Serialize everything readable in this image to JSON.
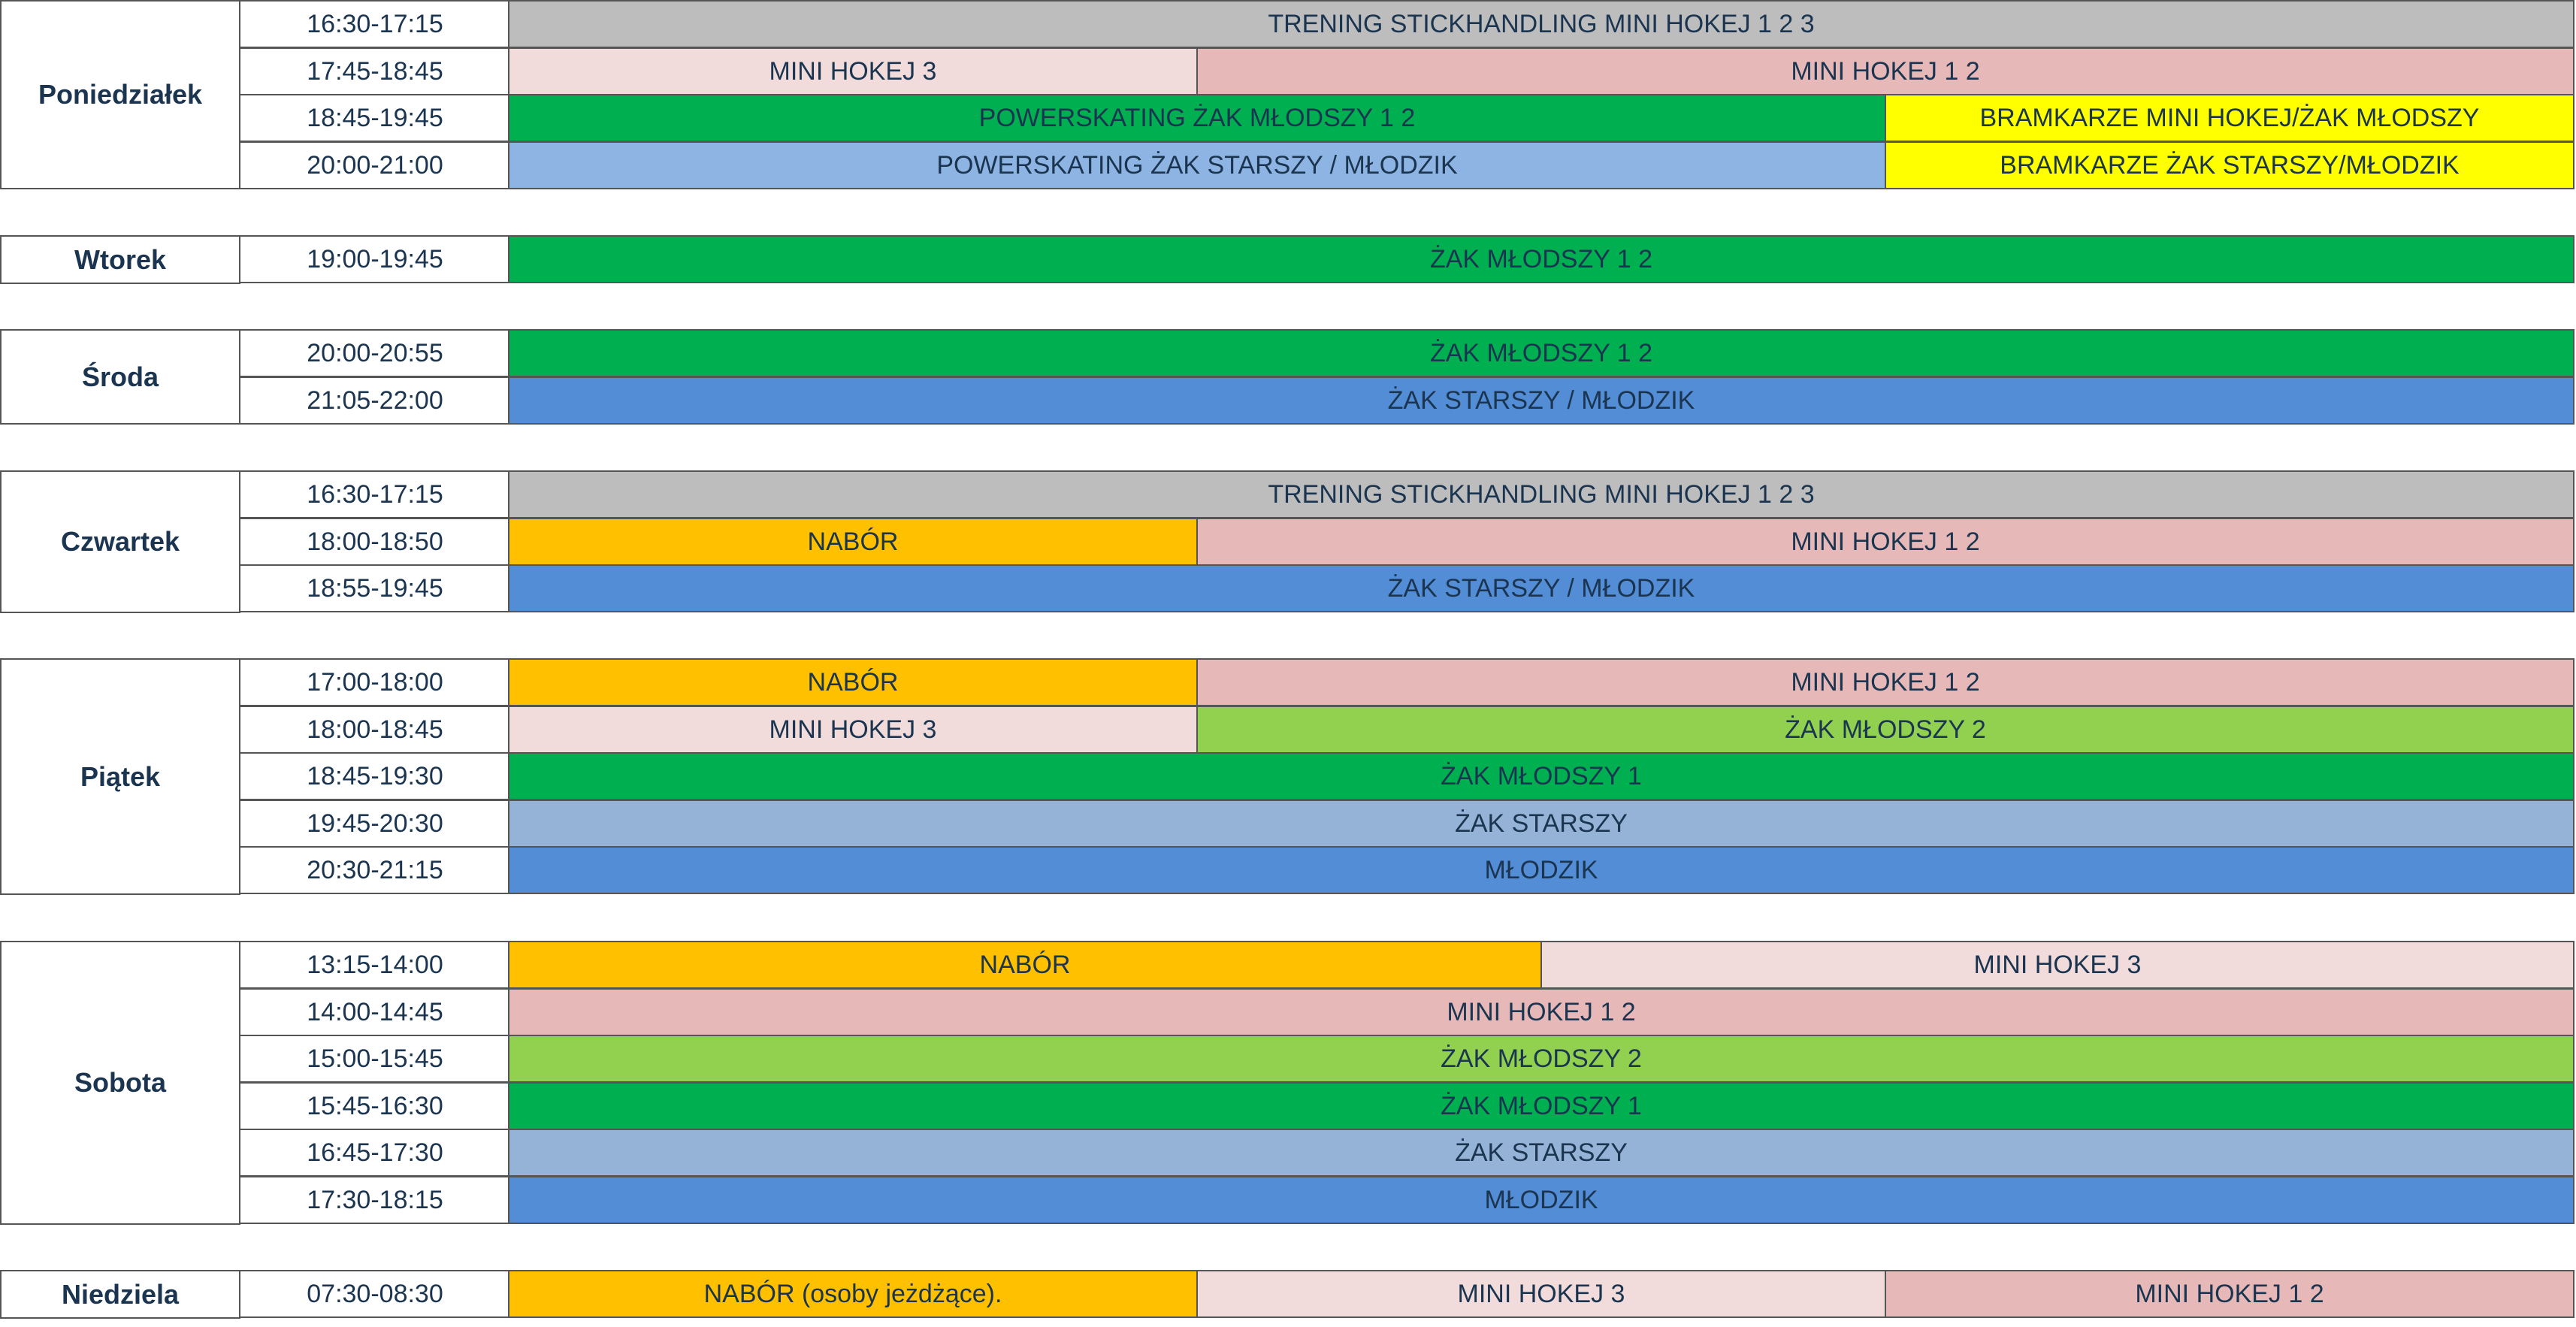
{
  "colors": {
    "gray": "#bdbdbd",
    "pink_light": "#f2dcdb",
    "pink": "#e6b8b7",
    "green_dark": "#00b050",
    "green_light": "#92d050",
    "blue_light": "#8db4e2",
    "blue_gray": "#95b3d7",
    "blue": "#538dd5",
    "yellow": "#ffff00",
    "orange": "#ffc000",
    "text": "#1b3550"
  },
  "days": [
    {
      "day": "Poniedziałek",
      "rows": [
        {
          "time": "16:30-17:15",
          "cells": [
            {
              "label": "TRENING STICKHANDLING MINI HOKEJ 1 2 3",
              "color": "#bdbdbd",
              "span": 6
            }
          ]
        },
        {
          "time": "17:45-18:45",
          "cells": [
            {
              "label": "MINI HOKEJ 3",
              "color": "#f2dcdb",
              "span": 2
            },
            {
              "label": "MINI HOKEJ 1 2",
              "color": "#e6b8b7",
              "span": 4
            }
          ]
        },
        {
          "time": "18:45-19:45",
          "cells": [
            {
              "label": "POWERSKATING ŻAK MŁODSZY 1 2",
              "color": "#00b050",
              "span": 4
            },
            {
              "label": "BRAMKARZE MINI HOKEJ/ŻAK MŁODSZY",
              "color": "#ffff00",
              "span": 2
            }
          ]
        },
        {
          "time": "20:00-21:00",
          "cells": [
            {
              "label": "POWERSKATING ŻAK STARSZY / MŁODZIK",
              "color": "#8db4e2",
              "span": 4
            },
            {
              "label": "BRAMKARZE ŻAK STARSZY/MŁODZIK",
              "color": "#ffff00",
              "span": 2
            }
          ]
        }
      ]
    },
    {
      "day": "Wtorek",
      "rows": [
        {
          "time": "19:00-19:45",
          "cells": [
            {
              "label": "ŻAK MŁODSZY 1 2",
              "color": "#00b050",
              "span": 6
            }
          ]
        }
      ]
    },
    {
      "day": "Środa",
      "rows": [
        {
          "time": "20:00-20:55",
          "cells": [
            {
              "label": "ŻAK MŁODSZY 1 2",
              "color": "#00b050",
              "span": 6
            }
          ]
        },
        {
          "time": "21:05-22:00",
          "cells": [
            {
              "label": "ŻAK STARSZY / MŁODZIK",
              "color": "#538dd5",
              "span": 6
            }
          ]
        }
      ]
    },
    {
      "day": "Czwartek",
      "rows": [
        {
          "time": "16:30-17:15",
          "cells": [
            {
              "label": "TRENING STICKHANDLING MINI HOKEJ 1 2 3",
              "color": "#bdbdbd",
              "span": 6
            }
          ]
        },
        {
          "time": "18:00-18:50",
          "cells": [
            {
              "label": "NABÓR",
              "color": "#ffc000",
              "span": 2
            },
            {
              "label": "MINI HOKEJ 1 2",
              "color": "#e6b8b7",
              "span": 4
            }
          ]
        },
        {
          "time": "18:55-19:45",
          "cells": [
            {
              "label": "ŻAK STARSZY / MŁODZIK",
              "color": "#538dd5",
              "span": 6
            }
          ]
        }
      ]
    },
    {
      "day": "Piątek",
      "rows": [
        {
          "time": "17:00-18:00",
          "cells": [
            {
              "label": "NABÓR",
              "color": "#ffc000",
              "span": 2
            },
            {
              "label": "MINI HOKEJ 1 2",
              "color": "#e6b8b7",
              "span": 4
            }
          ]
        },
        {
          "time": "18:00-18:45",
          "cells": [
            {
              "label": "MINI HOKEJ 3",
              "color": "#f2dcdb",
              "span": 2
            },
            {
              "label": "ŻAK MŁODSZY 2",
              "color": "#92d050",
              "span": 4
            }
          ]
        },
        {
          "time": "18:45-19:30",
          "cells": [
            {
              "label": "ŻAK MŁODSZY 1",
              "color": "#00b050",
              "span": 6
            }
          ]
        },
        {
          "time": "19:45-20:30",
          "cells": [
            {
              "label": "ŻAK STARSZY",
              "color": "#95b3d7",
              "span": 6
            }
          ]
        },
        {
          "time": "20:30-21:15",
          "cells": [
            {
              "label": "MŁODZIK",
              "color": "#538dd5",
              "span": 6
            }
          ]
        }
      ]
    },
    {
      "day": "Sobota",
      "rows": [
        {
          "time": "13:15-14:00",
          "cells": [
            {
              "label": "NABÓR",
              "color": "#ffc000",
              "span": 3
            },
            {
              "label": "MINI HOKEJ 3",
              "color": "#f2dcdb",
              "span": 3
            }
          ]
        },
        {
          "time": "14:00-14:45",
          "cells": [
            {
              "label": "MINI HOKEJ 1 2",
              "color": "#e6b8b7",
              "span": 6
            }
          ]
        },
        {
          "time": "15:00-15:45",
          "cells": [
            {
              "label": "ŻAK MŁODSZY 2",
              "color": "#92d050",
              "span": 6
            }
          ]
        },
        {
          "time": "15:45-16:30",
          "cells": [
            {
              "label": "ŻAK MŁODSZY 1",
              "color": "#00b050",
              "span": 6
            }
          ]
        },
        {
          "time": "16:45-17:30",
          "cells": [
            {
              "label": "ŻAK STARSZY",
              "color": "#95b3d7",
              "span": 6
            }
          ]
        },
        {
          "time": "17:30-18:15",
          "cells": [
            {
              "label": "MŁODZIK",
              "color": "#538dd5",
              "span": 6
            }
          ]
        }
      ]
    },
    {
      "day": "Niedziela",
      "rows": [
        {
          "time": "07:30-08:30",
          "cells": [
            {
              "label": "NABÓR (osoby jeżdżące).",
              "color": "#ffc000",
              "span": 2
            },
            {
              "label": "MINI HOKEJ 3",
              "color": "#f2dcdb",
              "span": 2
            },
            {
              "label": "MINI HOKEJ 1 2",
              "color": "#e6b8b7",
              "span": 2
            }
          ]
        }
      ]
    }
  ]
}
